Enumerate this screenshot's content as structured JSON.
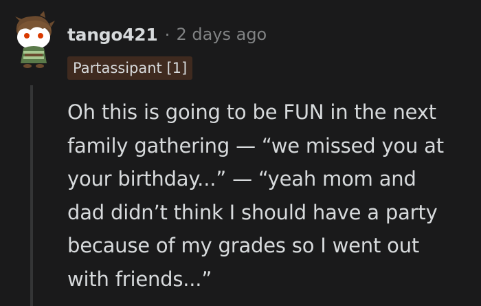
{
  "comment": {
    "username": "tango421",
    "separator": "·",
    "timestamp": "2 days ago",
    "flair": "Partassipant [1]",
    "avatar_icon": "reddit-snoo-avatar-icon",
    "body_lines": [
      "Oh this is going to be FUN in the next",
      "family gathering — “we missed you at",
      "your birthday...” — “yeah mom and",
      "dad didn’t think I should have a party",
      "because of my grades so I went out",
      "with friends...”"
    ]
  },
  "colors": {
    "background": "#1a1a1b",
    "text": "#d7dadc",
    "muted": "#818384",
    "flair_bg": "#3f2a1f",
    "thread_line": "#343536"
  }
}
